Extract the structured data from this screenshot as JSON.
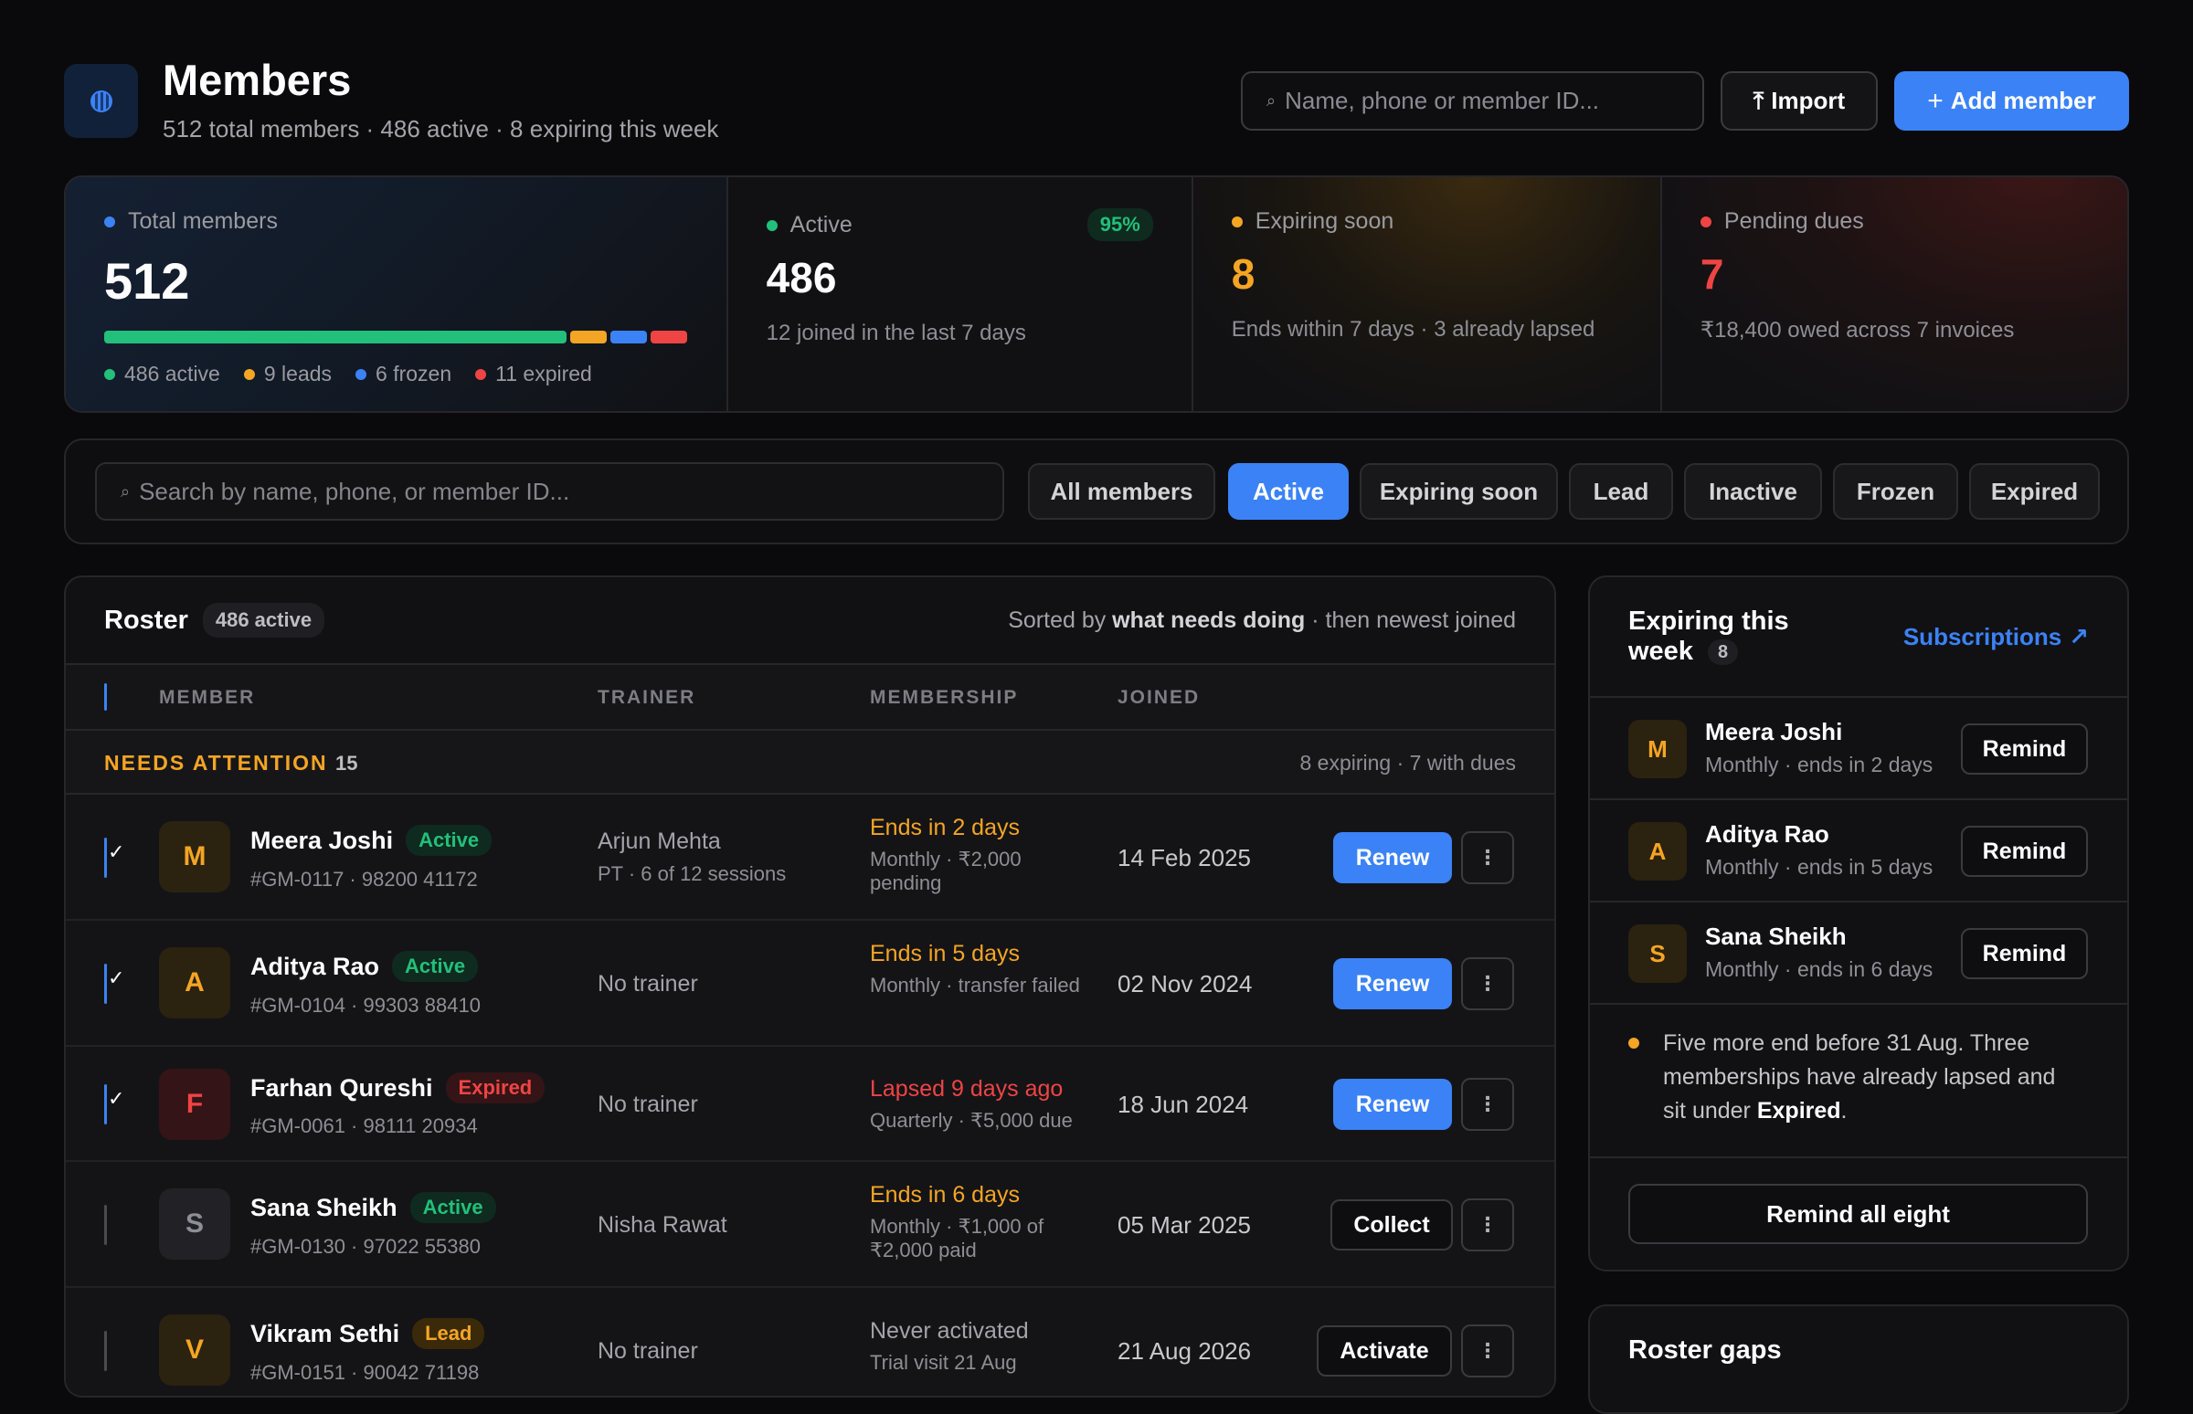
{
  "header": {
    "title": "Members",
    "subtitle": "512 total members · 486 active · 8 expiring this week",
    "search_placeholder": "Name, phone or member ID...",
    "import_label": "Import",
    "add_label": "Add member"
  },
  "stats": {
    "total": {
      "label": "Total members",
      "value": "512",
      "bar": [
        {
          "value": 486,
          "color": "#22c07a"
        },
        {
          "value": 9,
          "color": "#f5a524"
        },
        {
          "value": 6,
          "color": "#3b82f6"
        },
        {
          "value": 11,
          "color": "#ef4444"
        }
      ],
      "legend": [
        "486 active",
        "9 leads",
        "6 frozen",
        "11 expired"
      ]
    },
    "active": {
      "label": "Active",
      "value": "486",
      "sub": "12 joined in the last 7 days",
      "pct": "95%"
    },
    "expiring": {
      "label": "Expiring soon",
      "value": "8",
      "sub": "Ends within 7 days · 3 already lapsed"
    },
    "dues": {
      "label": "Pending dues",
      "value": "7",
      "sub": "₹18,400 owed across 7 invoices"
    }
  },
  "filters": {
    "search_placeholder": "Search by name, phone, or member ID...",
    "chips": [
      "All members",
      "Active",
      "Expiring soon",
      "Lead",
      "Inactive",
      "Frozen",
      "Expired"
    ],
    "selected": "Active"
  },
  "roster": {
    "title": "Roster",
    "badge": "486 active",
    "sort_prefix": "Sorted by ",
    "sort_bold": "what needs doing",
    "sort_suffix": " · then newest joined",
    "columns": {
      "member": "MEMBER",
      "trainer": "TRAINER",
      "membership": "MEMBERSHIP",
      "joined": "JOINED"
    },
    "attention_label": "NEEDS ATTENTION",
    "attention_count": "15",
    "attention_summary": "8 expiring · 7 with dues",
    "rows": [
      {
        "initial": "M",
        "name": "Meera Joshi",
        "status": "Active",
        "meta": "#GM-0117 · 98200 41172",
        "trainer": "Arjun Mehta",
        "trainer_sub": "PT · 6 of 12 sessions",
        "mstatus": "Ends in 2 days",
        "msub": "Monthly · ₹2,000 pending",
        "joined": "14 Feb 2025",
        "action": "Renew"
      },
      {
        "initial": "A",
        "name": "Aditya Rao",
        "status": "Active",
        "meta": "#GM-0104 · 99303 88410",
        "trainer": "No trainer",
        "trainer_sub": "",
        "mstatus": "Ends in 5 days",
        "msub": "Monthly · transfer failed",
        "joined": "02 Nov 2024",
        "action": "Renew"
      },
      {
        "initial": "F",
        "name": "Farhan Qureshi",
        "status": "Expired",
        "meta": "#GM-0061 · 98111 20934",
        "trainer": "No trainer",
        "trainer_sub": "",
        "mstatus": "Lapsed 9 days ago",
        "msub": "Quarterly · ₹5,000 due",
        "joined": "18 Jun 2024",
        "action": "Renew"
      },
      {
        "initial": "S",
        "name": "Sana Sheikh",
        "status": "Active",
        "meta": "#GM-0130 · 97022 55380",
        "trainer": "Nisha Rawat",
        "trainer_sub": "",
        "mstatus": "Ends in 6 days",
        "msub": "Monthly · ₹1,000 of ₹2,000 paid",
        "joined": "05 Mar 2025",
        "action": "Collect"
      },
      {
        "initial": "V",
        "name": "Vikram Sethi",
        "status": "Lead",
        "meta": "#GM-0151 · 90042 71198",
        "trainer": "No trainer",
        "trainer_sub": "",
        "mstatus": "Never activated",
        "msub": "Trial visit 21 Aug",
        "joined": "21 Aug 2026",
        "action": "Activate"
      }
    ]
  },
  "expiring_panel": {
    "title_line1": "Expiring this",
    "title_line2": "week",
    "count": "8",
    "link": "Subscriptions",
    "items": [
      {
        "initial": "M",
        "name": "Meera Joshi",
        "sub": "Monthly · ends in 2 days",
        "action": "Remind"
      },
      {
        "initial": "A",
        "name": "Aditya Rao",
        "sub": "Monthly · ends in 5 days",
        "action": "Remind"
      },
      {
        "initial": "S",
        "name": "Sana Sheikh",
        "sub": "Monthly · ends in 6 days",
        "action": "Remind"
      }
    ],
    "note_line1": "Five more end before 31 Aug. Three",
    "note_line2": "memberships have already lapsed and",
    "note_line3_prefix": "sit under ",
    "note_line3_bold": "Expired",
    "note_line3_suffix": ".",
    "remind_all": "Remind all eight"
  },
  "gaps_panel": {
    "title": "Roster gaps"
  },
  "colors": {
    "accent": "#3b82f6",
    "green": "#22c07a",
    "amber": "#f5a524",
    "red": "#ef4444"
  }
}
